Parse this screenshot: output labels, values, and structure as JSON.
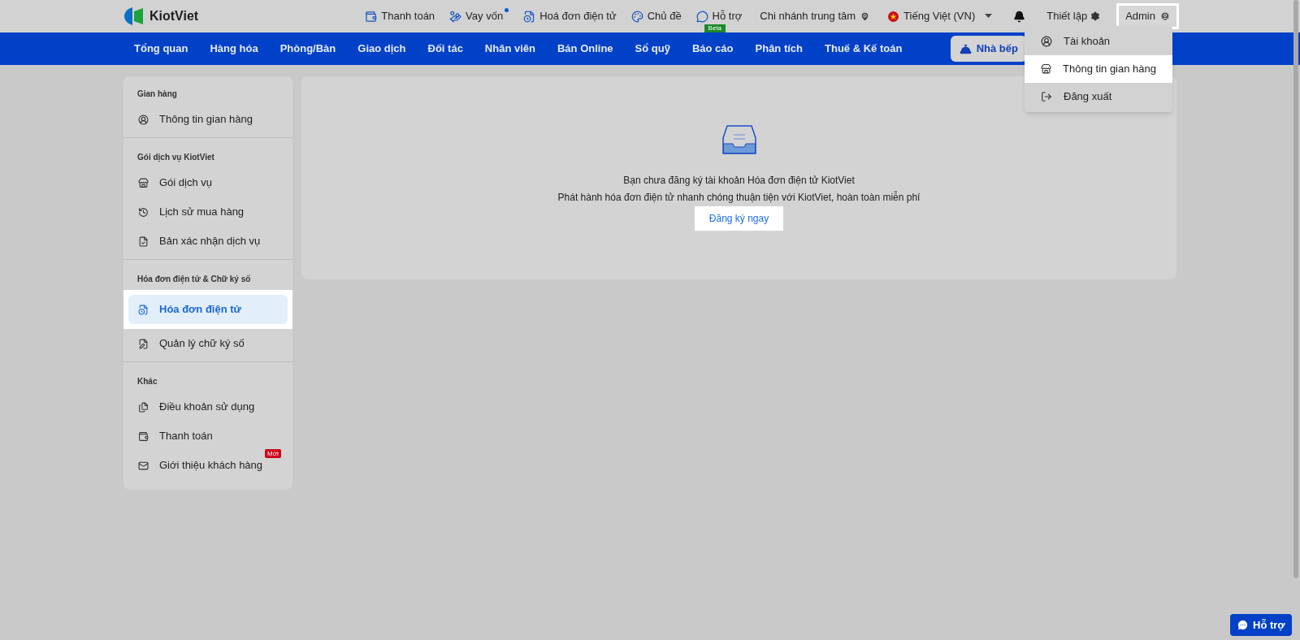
{
  "logo": {
    "text": "KiotViet"
  },
  "top_links": [
    {
      "label": "Thanh toán",
      "kind": "wallet",
      "notification_dot": false
    },
    {
      "label": "Vay vốn",
      "kind": "moneybag",
      "notification_dot": true
    },
    {
      "label": "Hoá đơn điện tử",
      "kind": "invoice",
      "notification_dot": false
    },
    {
      "label": "Chủ đề",
      "kind": "palette",
      "notification_dot": false
    },
    {
      "label": "Hỗ trợ",
      "kind": "chat",
      "notification_dot": false,
      "badge": "Beta"
    }
  ],
  "branch": "Chi nhánh trung tâm",
  "language": "Tiếng Việt (VN)",
  "settings": "Thiết lập",
  "user": "Admin",
  "user_menu": [
    {
      "label": "Tài khoản",
      "kind": "user",
      "selected": false
    },
    {
      "label": "Thông tin gian hàng",
      "kind": "store",
      "selected": true
    },
    {
      "label": "Đăng xuất",
      "kind": "logout",
      "selected": false
    }
  ],
  "nav": {
    "items": [
      "Tổng quan",
      "Hàng hóa",
      "Phòng/Bàn",
      "Giao dịch",
      "Đối tác",
      "Nhân viên",
      "Bán Online",
      "Sổ quỹ",
      "Báo cáo",
      "Phân tích",
      "Thuế & Kế toán"
    ],
    "kitchen_button": "Nhà bếp"
  },
  "sidebar": {
    "sections": [
      {
        "title": "Gian hàng",
        "items": [
          {
            "label": "Thông tin gian hàng",
            "kind": "user",
            "selected": false
          }
        ]
      },
      {
        "title": "Gói dịch vụ KiotViet",
        "items": [
          {
            "label": "Gói dịch vụ",
            "kind": "store",
            "selected": false
          },
          {
            "label": "Lịch sử mua hàng",
            "kind": "history",
            "selected": false
          },
          {
            "label": "Bản xác nhận dịch vụ",
            "kind": "filecheck",
            "selected": false
          }
        ]
      },
      {
        "title": "Hóa đơn điện tử & Chữ ký số",
        "items": [
          {
            "label": "Hóa đơn điện tử",
            "kind": "invoice",
            "selected": true
          },
          {
            "label": "Quản lý chữ ký số",
            "kind": "sign",
            "selected": false
          }
        ]
      },
      {
        "title": "Khác",
        "items": [
          {
            "label": "Điều khoản sử dụng",
            "kind": "files",
            "selected": false
          },
          {
            "label": "Thanh toán",
            "kind": "wallet",
            "selected": false
          },
          {
            "label": "Giới thiệu khách hàng",
            "kind": "mail",
            "selected": false,
            "badge": "Mới"
          }
        ]
      }
    ]
  },
  "empty_state": {
    "title": "Bạn chưa đăng ký tài khoản Hóa đơn điện tử KiotViet",
    "subtitle": "Phát hành hóa đơn điện tử nhanh chóng thuận tiện với KiotViet, hoàn toàn miễn phí",
    "action": "Đăng ký ngay"
  },
  "help_button": "Hỗ trợ"
}
